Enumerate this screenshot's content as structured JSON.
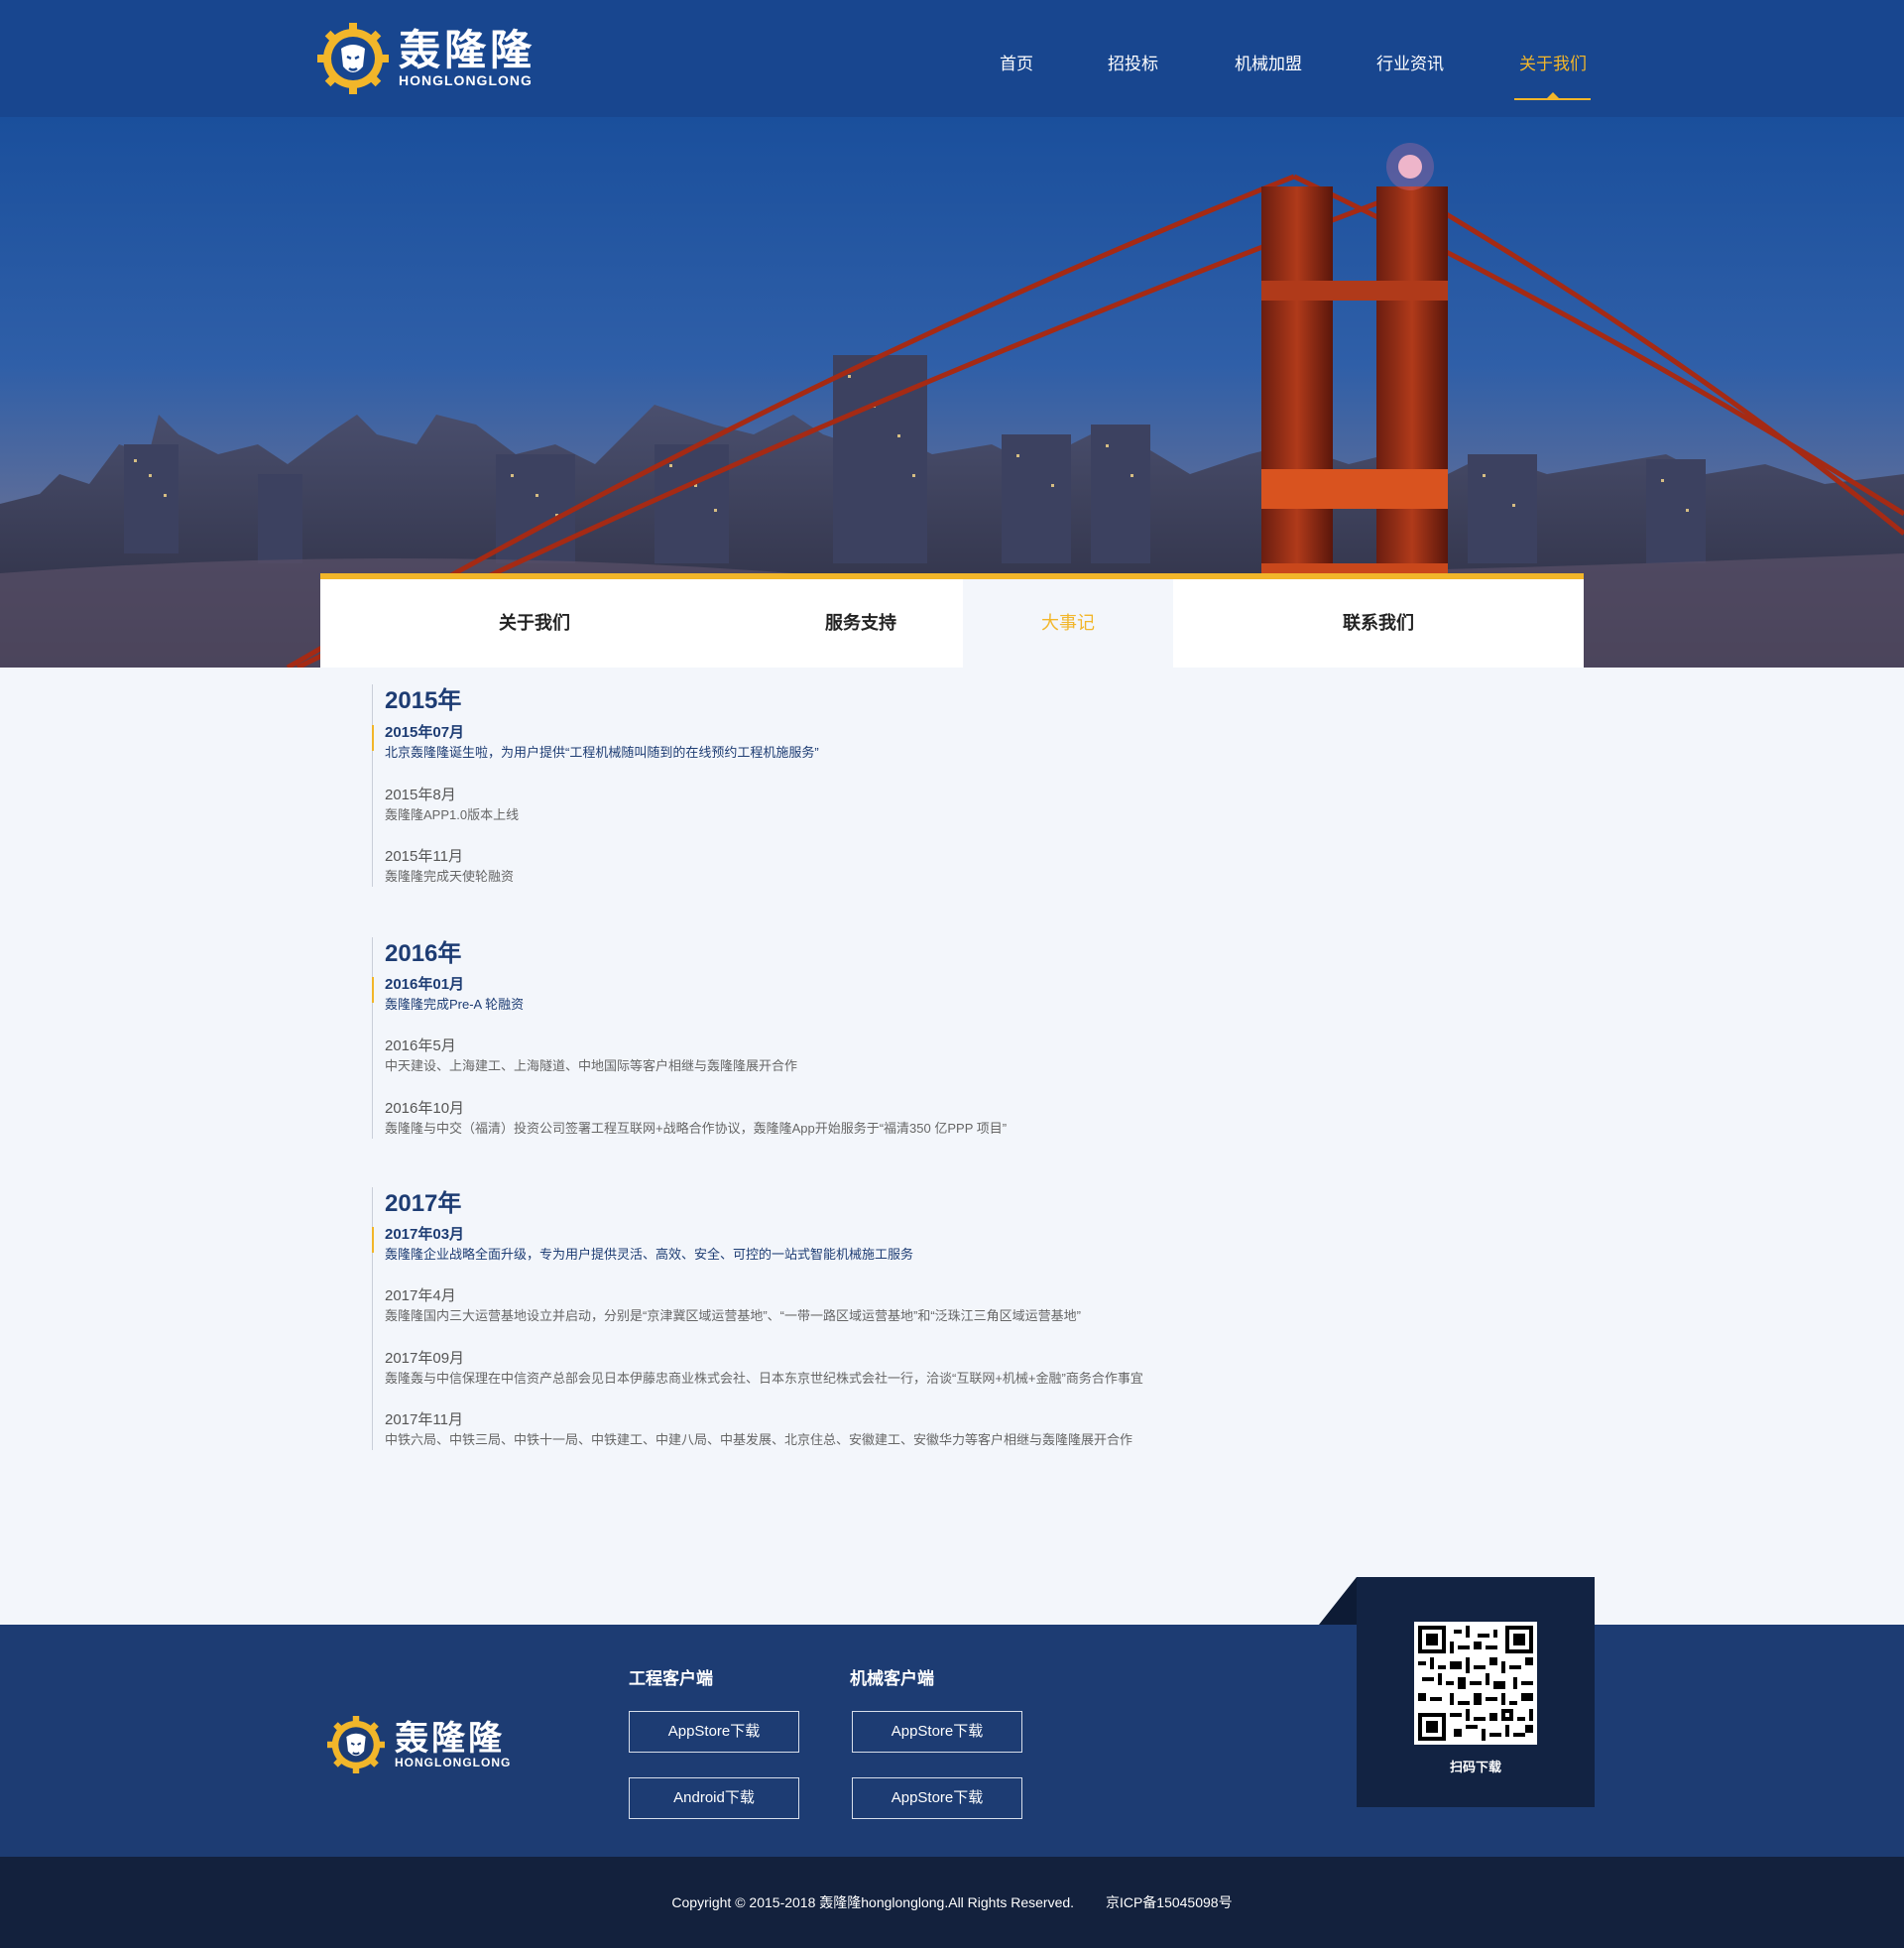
{
  "brand": {
    "name_cn": "轰隆隆",
    "name_en": "HONGLONGLONG"
  },
  "nav": {
    "items": [
      "首页",
      "招投标",
      "机械加盟",
      "行业资讯",
      "关于我们"
    ],
    "active_index": 4
  },
  "tabs": {
    "items": [
      "关于我们",
      "服务支持",
      "大事记",
      "联系我们"
    ],
    "active_index": 2
  },
  "timeline": [
    {
      "year": "2015年",
      "events": [
        {
          "date": "2015年07月",
          "desc": "北京轰隆隆诞生啦，为用户提供“工程机械随叫随到的在线预约工程机施服务”",
          "highlight": true
        },
        {
          "date": "2015年8月",
          "desc": "轰隆隆APP1.0版本上线",
          "highlight": false
        },
        {
          "date": "2015年11月",
          "desc": "轰隆隆完成天使轮融资",
          "highlight": false
        }
      ]
    },
    {
      "year": "2016年",
      "events": [
        {
          "date": "2016年01月",
          "desc": "轰隆隆完成Pre-A 轮融资",
          "highlight": true
        },
        {
          "date": "2016年5月",
          "desc": "中天建设、上海建工、上海隧道、中地国际等客户相继与轰隆隆展开合作",
          "highlight": false
        },
        {
          "date": "2016年10月",
          "desc": "轰隆隆与中交（福清）投资公司签署工程互联网+战略合作协议，轰隆隆App开始服务于“福清350 亿PPP 项目”",
          "highlight": false
        }
      ]
    },
    {
      "year": "2017年",
      "events": [
        {
          "date": "2017年03月",
          "desc": "轰隆隆企业战略全面升级，专为用户提供灵活、高效、安全、可控的一站式智能机械施工服务",
          "highlight": true
        },
        {
          "date": "2017年4月",
          "desc": "轰隆隆国内三大运营基地设立并启动，分别是“京津冀区域运营基地”、“一带一路区域运营基地”和“泛珠江三角区域运营基地”",
          "highlight": false
        },
        {
          "date": "2017年09月",
          "desc": "轰隆轰与中信保理在中信资产总部会见日本伊藤忠商业株式会社、日本东京世纪株式会社一行，洽谈“互联网+机械+金融”商务合作事宜",
          "highlight": false
        },
        {
          "date": "2017年11月",
          "desc": "中铁六局、中铁三局、中铁十一局、中铁建工、中建八局、中基发展、北京住总、安徽建工、安徽华力等客户相继与轰隆隆展开合作",
          "highlight": false
        }
      ]
    }
  ],
  "footer": {
    "engineering": {
      "title": "工程客户端",
      "buttons": [
        "AppStore下载",
        "Android下载"
      ]
    },
    "machinery": {
      "title": "机械客户端",
      "buttons": [
        "AppStore下载",
        "AppStore下载"
      ]
    },
    "qr_label": "扫码下载",
    "copyright": "Copyright © 2015-2018 轰隆隆honglonglong.All Rights Reserved.",
    "icp": "京ICP备15045098号"
  },
  "colors": {
    "header_bg": "#18468f",
    "accent": "#f2b62a",
    "footer_bg": "#1d3c73",
    "copyright_bg": "#13213d",
    "title_text": "#1d3c73"
  }
}
